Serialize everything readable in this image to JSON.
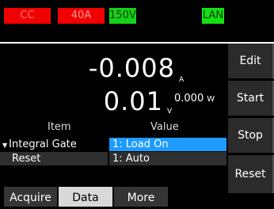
{
  "status": {
    "mode": "CC",
    "current_range": "40A",
    "voltage_range": "150V",
    "interface": "LAN"
  },
  "measurement": {
    "current_value": "-0.008",
    "current_unit": "A",
    "voltage_value": "0.01",
    "voltage_unit": "V",
    "power_value": "0.000",
    "power_unit": "W"
  },
  "table": {
    "headers": {
      "item": "Item",
      "value": "Value"
    },
    "rows": [
      {
        "item": "Integral Gate",
        "value": "1: Load On",
        "expanded": true
      },
      {
        "item": "Reset",
        "value": "1: Auto"
      }
    ]
  },
  "side_menu": {
    "edit": "Edit",
    "start": "Start",
    "stop": "Stop",
    "reset": "Reset"
  },
  "tabs": {
    "acquire": "Acquire",
    "data": "Data",
    "more": "More"
  },
  "colors": {
    "cc_badge": "#f00000",
    "range_badge_green": "#17d117",
    "selected_row": "#1e9bff",
    "active_tab": "#d9d9d9"
  }
}
